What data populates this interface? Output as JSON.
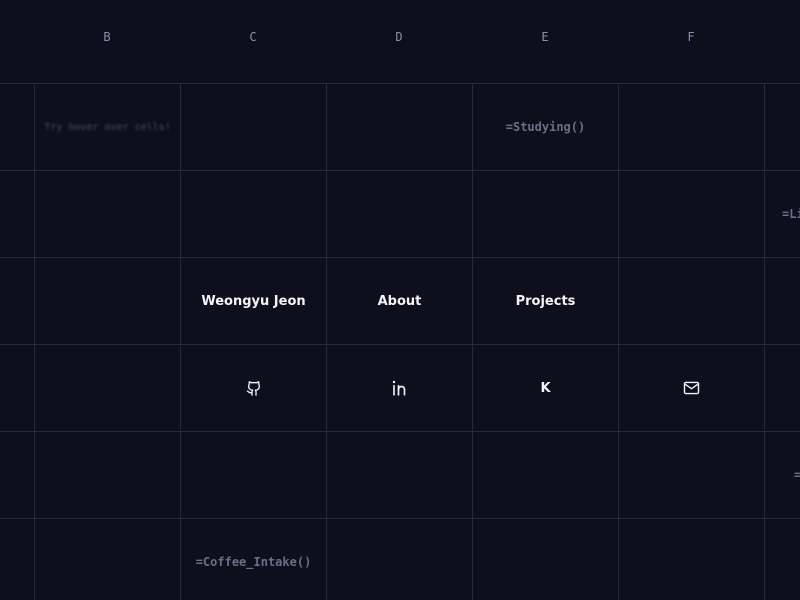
{
  "columns": [
    "B",
    "C",
    "D",
    "E",
    "F"
  ],
  "hint": "Try hover over cells!",
  "formulas": {
    "studying": "=Studying()",
    "coffee": "=Coffee_Intake()",
    "edge_row2": "=Li",
    "edge_row5": "="
  },
  "nav": {
    "name": "Weongyu Jeon",
    "about": "About",
    "projects": "Projects"
  },
  "social": {
    "github_icon": "github-icon",
    "linkedin_icon": "linkedin-icon",
    "k_label": "K",
    "mail_icon": "mail-icon"
  },
  "colors": {
    "background": "#0e0e1c",
    "grid": "#2a2a3c",
    "text": "#f3f3f8",
    "muted": "#6c6e86"
  }
}
